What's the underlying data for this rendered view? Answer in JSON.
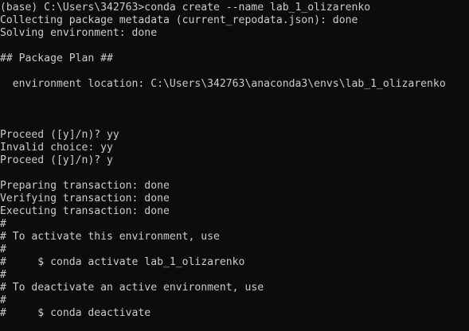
{
  "console": {
    "lines": [
      "(base) C:\\Users\\342763>conda create --name lab_1_olizarenko",
      "Collecting package metadata (current_repodata.json): done",
      "Solving environment: done",
      "",
      "## Package Plan ##",
      "",
      "  environment location: C:\\Users\\342763\\anaconda3\\envs\\lab_1_olizarenko",
      "",
      "",
      "",
      "Proceed ([y]/n)? yy",
      "Invalid choice: yy",
      "Proceed ([y]/n)? y",
      "",
      "Preparing transaction: done",
      "Verifying transaction: done",
      "Executing transaction: done",
      "#",
      "# To activate this environment, use",
      "#",
      "#     $ conda activate lab_1_olizarenko",
      "#",
      "# To deactivate an active environment, use",
      "#",
      "#     $ conda deactivate"
    ]
  }
}
